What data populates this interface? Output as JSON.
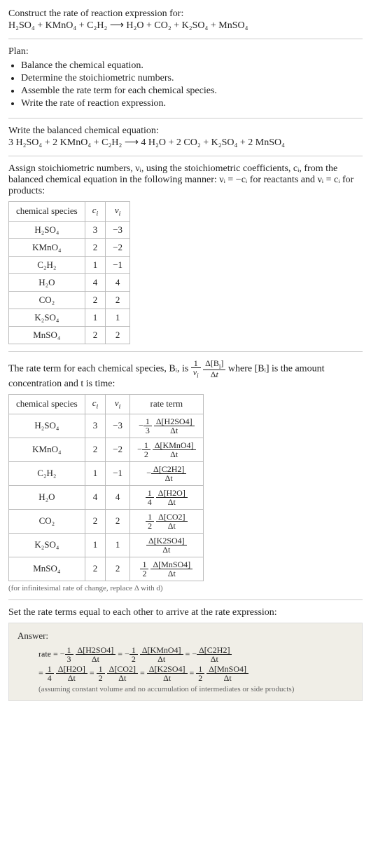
{
  "intro": {
    "construct_label": "Construct the rate of reaction expression for:",
    "unbalanced_eq": "H₂SO₄ + KMnO₄ + C₂H₂ ⟶ H₂O + CO₂ + K₂SO₄ + MnSO₄"
  },
  "plan": {
    "heading": "Plan:",
    "items": [
      "Balance the chemical equation.",
      "Determine the stoichiometric numbers.",
      "Assemble the rate term for each chemical species.",
      "Write the rate of reaction expression."
    ]
  },
  "balanced": {
    "heading": "Write the balanced chemical equation:",
    "equation": "3 H₂SO₄ + 2 KMnO₄ + C₂H₂ ⟶ 4 H₂O + 2 CO₂ + K₂SO₄ + 2 MnSO₄"
  },
  "stoich_intro": "Assign stoichiometric numbers, νᵢ, using the stoichiometric coefficients, cᵢ, from the balanced chemical equation in the following manner: νᵢ = −cᵢ for reactants and νᵢ = cᵢ for products:",
  "stoich_table": {
    "headers": [
      "chemical species",
      "cᵢ",
      "νᵢ"
    ],
    "rows": [
      {
        "species": "H₂SO₄",
        "c": "3",
        "v": "−3"
      },
      {
        "species": "KMnO₄",
        "c": "2",
        "v": "−2"
      },
      {
        "species": "C₂H₂",
        "c": "1",
        "v": "−1"
      },
      {
        "species": "H₂O",
        "c": "4",
        "v": "4"
      },
      {
        "species": "CO₂",
        "c": "2",
        "v": "2"
      },
      {
        "species": "K₂SO₄",
        "c": "1",
        "v": "1"
      },
      {
        "species": "MnSO₄",
        "c": "2",
        "v": "2"
      }
    ]
  },
  "rate_intro_pre": "The rate term for each chemical species, Bᵢ, is ",
  "rate_intro_post": " where [Bᵢ] is the amount concentration and t is time:",
  "rate_table": {
    "headers": [
      "chemical species",
      "cᵢ",
      "νᵢ",
      "rate term"
    ],
    "rows": [
      {
        "species": "H₂SO₄",
        "c": "3",
        "v": "−3",
        "neg": "−",
        "coef_num": "1",
        "coef_den": "3",
        "delta": "Δ[H2SO4]"
      },
      {
        "species": "KMnO₄",
        "c": "2",
        "v": "−2",
        "neg": "−",
        "coef_num": "1",
        "coef_den": "2",
        "delta": "Δ[KMnO4]"
      },
      {
        "species": "C₂H₂",
        "c": "1",
        "v": "−1",
        "neg": "−",
        "coef_num": "",
        "coef_den": "",
        "delta": "Δ[C2H2]"
      },
      {
        "species": "H₂O",
        "c": "4",
        "v": "4",
        "neg": "",
        "coef_num": "1",
        "coef_den": "4",
        "delta": "Δ[H2O]"
      },
      {
        "species": "CO₂",
        "c": "2",
        "v": "2",
        "neg": "",
        "coef_num": "1",
        "coef_den": "2",
        "delta": "Δ[CO2]"
      },
      {
        "species": "K₂SO₄",
        "c": "1",
        "v": "1",
        "neg": "",
        "coef_num": "",
        "coef_den": "",
        "delta": "Δ[K2SO4]"
      },
      {
        "species": "MnSO₄",
        "c": "2",
        "v": "2",
        "neg": "",
        "coef_num": "1",
        "coef_den": "2",
        "delta": "Δ[MnSO4]"
      }
    ]
  },
  "rate_note": "(for infinitesimal rate of change, replace Δ with d)",
  "final_heading": "Set the rate terms equal to each other to arrive at the rate expression:",
  "answer": {
    "label": "Answer:",
    "line1_pre": "rate = ",
    "assumption": "(assuming constant volume and no accumulation of intermediates or side products)"
  },
  "dt": "Δt"
}
